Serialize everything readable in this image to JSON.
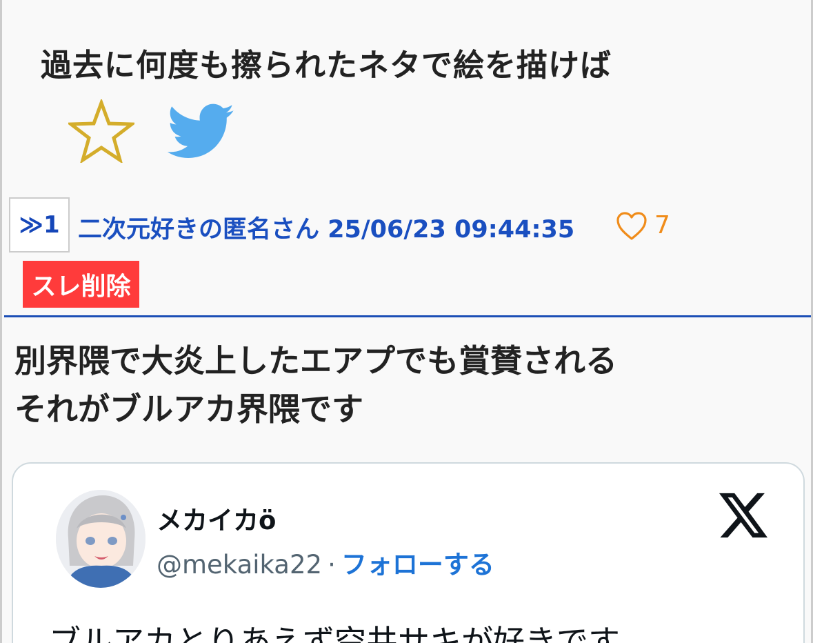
{
  "thread": {
    "title": "過去に何度も擦られたネタで絵を描けば",
    "favorite_icon": "star-outline-icon",
    "share_icon": "twitter-bird-icon"
  },
  "post": {
    "res_label": "≫1",
    "poster_line": "二次元好きの匿名さん 25/06/23 09:44:35",
    "like_icon": "heart-outline-icon",
    "like_count": "7",
    "delete_label": "スレ削除",
    "body_lines": [
      "別界隈で大炎上したエアプでも賞賛される",
      "それがブルアカ界隈です"
    ]
  },
  "embed": {
    "author_name": "メカイカö",
    "handle": "@mekaika22",
    "separator": "·",
    "follow_label": "フォローする",
    "logo_icon": "x-logo-icon",
    "text": "ブルアカとりあえず空井サキが好きです"
  },
  "colors": {
    "accent_blue": "#1a4fc0",
    "divider_blue": "#1c4fb6",
    "star_gold": "#d4ad2b",
    "twitter_blue": "#55acee",
    "like_orange": "#f08c1a",
    "delete_red": "#ff3b3b"
  }
}
